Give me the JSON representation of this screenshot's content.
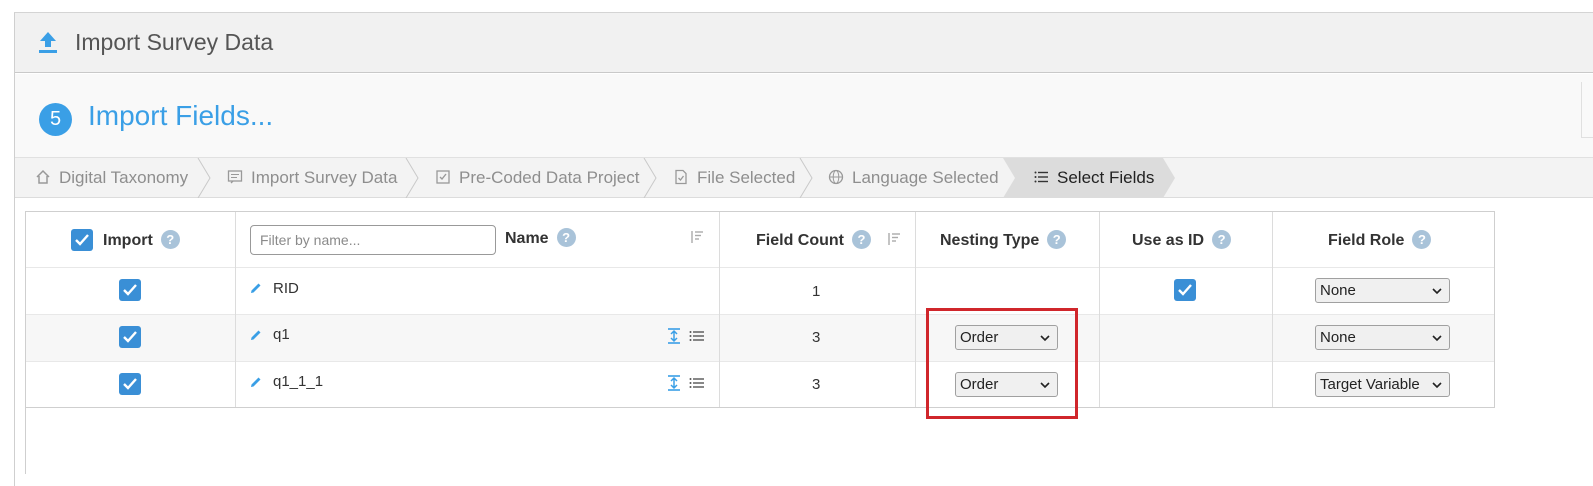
{
  "header": {
    "title": "Import Survey Data",
    "icon": "upload-icon"
  },
  "step": {
    "number": "5",
    "title": "Import Fields..."
  },
  "breadcrumbs": [
    {
      "label": "Digital Taxonomy",
      "icon": "home-icon"
    },
    {
      "label": "Import Survey Data",
      "icon": "message-icon"
    },
    {
      "label": "Pre-Coded Data Project",
      "icon": "checkbox-icon"
    },
    {
      "label": "File Selected",
      "icon": "file-check-icon"
    },
    {
      "label": "Language Selected",
      "icon": "globe-icon"
    },
    {
      "label": "Select Fields",
      "icon": "list-icon"
    }
  ],
  "table": {
    "headers": {
      "import": "Import",
      "name": "Name",
      "field_count": "Field Count",
      "nesting_type": "Nesting Type",
      "use_as_id": "Use as ID",
      "field_role": "Field Role"
    },
    "filter_placeholder": "Filter by name...",
    "help_glyph": "?",
    "rows": [
      {
        "name": "RID",
        "field_count": "1",
        "nesting_type": "",
        "use_as_id": true,
        "field_role": "None",
        "imported": true
      },
      {
        "name": "q1",
        "field_count": "3",
        "nesting_type": "Order",
        "use_as_id": false,
        "field_role": "None",
        "imported": true
      },
      {
        "name": "q1_1_1",
        "field_count": "3",
        "nesting_type": "Order",
        "use_as_id": false,
        "field_role": "Target Variable",
        "imported": true
      }
    ]
  },
  "colors": {
    "accent": "#3a9fe6",
    "checkbox": "#3a8fd6",
    "highlight": "#d0262b"
  }
}
